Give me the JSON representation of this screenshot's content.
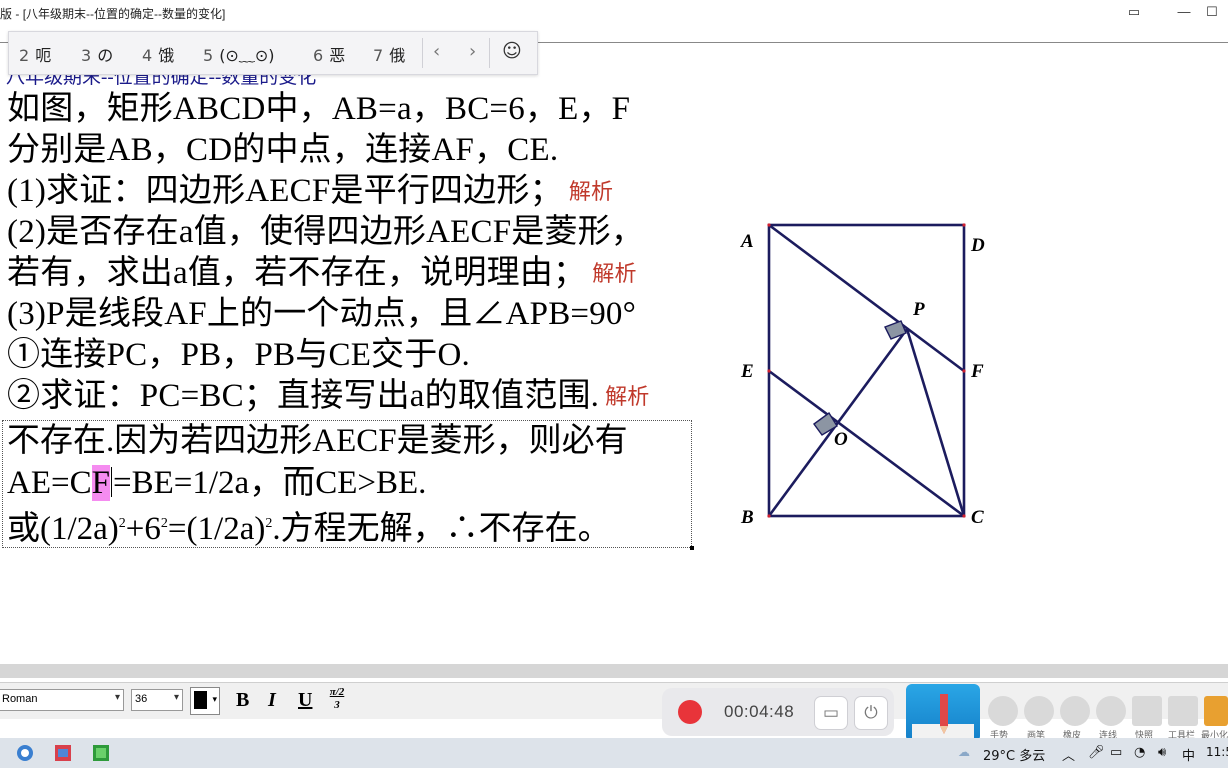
{
  "window": {
    "title": "[八年级期末--位置的确定--数量的变化]",
    "title_prefix": "版 -",
    "minimize_glyph": "—",
    "maximize_glyph": "☐",
    "more_glyph": "▭"
  },
  "ime": {
    "candidates": [
      {
        "num": "2",
        "text": "呃"
      },
      {
        "num": "3",
        "text": "の"
      },
      {
        "num": "4",
        "text": "饿"
      },
      {
        "num": "5",
        "text": "(⊙﹏⊙)"
      },
      {
        "num": "6",
        "text": "恶"
      },
      {
        "num": "7",
        "text": "俄"
      }
    ],
    "prev_glyph": "‹",
    "next_glyph": "›",
    "emoji_glyph": "☺"
  },
  "document": {
    "partial_heading": "八年级期末--位置的确定--数量的变化",
    "question_lines": [
      "如图，矩形ABCD中，AB=a，BC=6，E，F",
      "分别是AB，CD的中点，连接AF，CE.",
      "(1)求证：四边形AECF是平行四边形；",
      "(2)是否存在a值，使得四边形AECF是菱形，",
      "若有，求出a值，若不存在，说明理由；",
      "(3)P是线段AF上的一个动点，且∠APB=90°",
      "①连接PC，PB，PB与CE交于O.",
      "②求证：PC=BC；直接写出a的取值范围."
    ],
    "analysis_link": "解析",
    "answer": {
      "line1": "不存在.因为若四边形AECF是菱形，则必有",
      "line2_a": "AE=C",
      "line2_hl": "F",
      "line2_b": "=BE=1/2a，而CE>BE.",
      "line3_a": "或(1/2a)",
      "line3_sup1": "2",
      "line3_b": "+6",
      "line3_sup2": "2",
      "line3_c": "=(1/2a)",
      "line3_sup3": "2",
      "line3_d": ".方程无解，∴不存在。"
    }
  },
  "figure": {
    "labels": {
      "A": "A",
      "B": "B",
      "C": "C",
      "D": "D",
      "E": "E",
      "F": "F",
      "P": "P",
      "O": "O"
    }
  },
  "toolbar": {
    "font_name": "Roman",
    "font_size": "36",
    "bold": "B",
    "italic": "I",
    "underline": "U",
    "fraction_top": "π/2",
    "fraction_bottom": "3"
  },
  "recorder": {
    "elapsed": "00:04:48"
  },
  "pen_tools": [
    "手势",
    "画笔",
    "橡皮",
    "连线",
    "快照",
    "工具栏",
    "最小化"
  ],
  "taskbar": {
    "weather": "29°C 多云",
    "ime_mode": "中",
    "clock": "11:5"
  }
}
